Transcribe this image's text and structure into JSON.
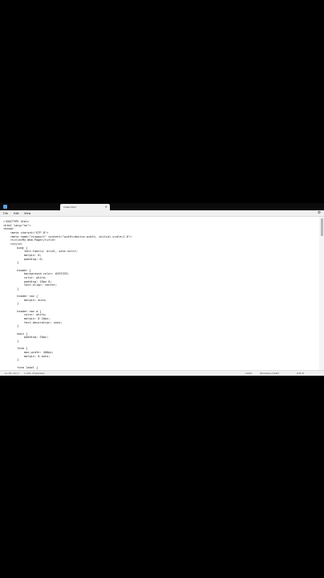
{
  "taskbar": {
    "app_icon": "notepad-icon",
    "tab_title": "index.html",
    "tab_close": "×"
  },
  "menubar": {
    "items": [
      "File",
      "Edit",
      "View"
    ],
    "settings_icon": "gear-icon",
    "settings_glyph": "⚙"
  },
  "editor": {
    "code": "<!DOCTYPE html>\n<html lang=\"en\">\n<head>\n    <meta charset=\"UTF-8\">\n    <meta name=\"viewport\" content=\"width=device-width, initial-scale=1.0\">\n    <title>My Web Page</title>\n    <style>\n        body {\n            font-family: Arial, sans-serif;\n            margin: 0;\n            padding: 0;\n        }\n\n        header {\n            background-color: #333333;\n            color: white;\n            padding: 10px 0;\n            text-align: center;\n        }\n\n        header nav {\n            margin: auto;\n        }\n\n        header nav a {\n            color: white;\n            margin: 0 10px;\n            text-decoration: none;\n        }\n\n        main {\n            padding: 20px;\n        }\n\n        form {\n            max-width: 400px;\n            margin: 0 auto;\n        }\n\n        form label {"
  },
  "statusbar": {
    "position": "Ln 75, Col 1",
    "selection": "1,341 characters",
    "zoom": "100%",
    "line_ending": "Windows (CRLF)",
    "encoding": "UTF-8"
  }
}
